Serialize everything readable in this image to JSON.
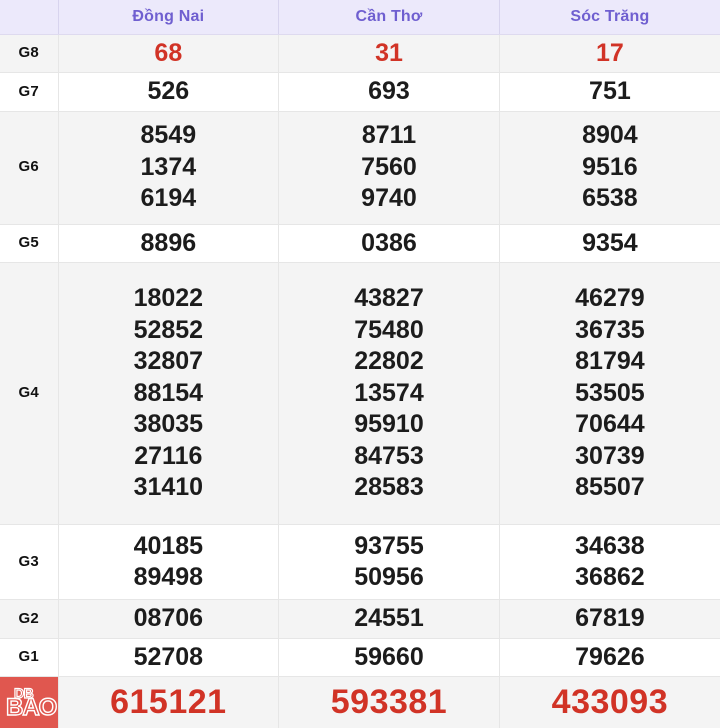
{
  "table": {
    "corner_label": "",
    "columns": [
      "Đồng Nai",
      "Cần Thơ",
      "Sóc Trăng"
    ],
    "colors": {
      "header_bg": "#ECE9FB",
      "header_text": "#6F5FD0",
      "alt_row_bg": "#F4F4F4",
      "plain_row_bg": "#FFFFFF",
      "value_text": "#1C1C1C",
      "highlight_text": "#D13326",
      "watermark_bg": "#E0574F",
      "border": "#E6E6E6"
    },
    "rows": [
      {
        "label": "G8",
        "style": "alt",
        "highlight": true,
        "cells": [
          [
            "68"
          ],
          [
            "31"
          ],
          [
            "17"
          ]
        ]
      },
      {
        "label": "G7",
        "style": "plain",
        "highlight": false,
        "cells": [
          [
            "526"
          ],
          [
            "693"
          ],
          [
            "751"
          ]
        ]
      },
      {
        "label": "G6",
        "style": "alt",
        "highlight": false,
        "cells": [
          [
            "8549",
            "1374",
            "6194"
          ],
          [
            "8711",
            "7560",
            "9740"
          ],
          [
            "8904",
            "9516",
            "6538"
          ]
        ]
      },
      {
        "label": "G5",
        "style": "plain",
        "highlight": false,
        "cells": [
          [
            "8896"
          ],
          [
            "0386"
          ],
          [
            "9354"
          ]
        ]
      },
      {
        "label": "G4",
        "style": "alt",
        "highlight": false,
        "cells": [
          [
            "18022",
            "52852",
            "32807",
            "88154",
            "38035",
            "27116",
            "31410"
          ],
          [
            "43827",
            "75480",
            "22802",
            "13574",
            "95910",
            "84753",
            "28583"
          ],
          [
            "46279",
            "36735",
            "81794",
            "53505",
            "70644",
            "30739",
            "85507"
          ]
        ]
      },
      {
        "label": "G3",
        "style": "plain",
        "highlight": false,
        "cells": [
          [
            "40185",
            "89498"
          ],
          [
            "93755",
            "50956"
          ],
          [
            "34638",
            "36862"
          ]
        ]
      },
      {
        "label": "G2",
        "style": "alt",
        "highlight": false,
        "cells": [
          [
            "08706"
          ],
          [
            "24551"
          ],
          [
            "67819"
          ]
        ]
      },
      {
        "label": "G1",
        "style": "plain",
        "highlight": false,
        "cells": [
          [
            "52708"
          ],
          [
            "59660"
          ],
          [
            "79626"
          ]
        ]
      }
    ],
    "special_row": {
      "label": "",
      "cells": [
        [
          "615121"
        ],
        [
          "593381"
        ],
        [
          "433093"
        ]
      ]
    }
  },
  "watermark": {
    "top_text": "DB",
    "bottom_text": "BAO"
  }
}
